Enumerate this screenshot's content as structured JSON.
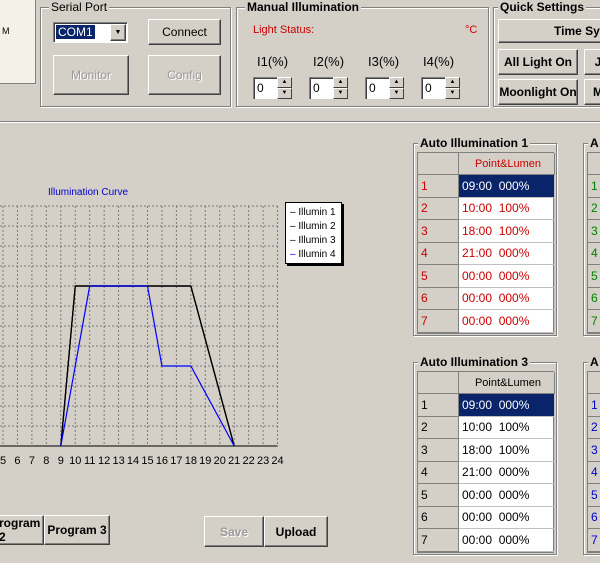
{
  "left_stub": {
    "text": "M"
  },
  "serial_port": {
    "title": "Serial Port",
    "port_value": "COM1",
    "connect_label": "Connect",
    "monitor_label": "Monitor",
    "config_label": "Config"
  },
  "manual": {
    "title": "Manual Illumination",
    "light_status_label": "Light Status:",
    "unit": "°C",
    "channels": [
      {
        "label": "I1(%)",
        "value": "0"
      },
      {
        "label": "I2(%)",
        "value": "0"
      },
      {
        "label": "I3(%)",
        "value": "0"
      },
      {
        "label": "I4(%)",
        "value": "0"
      }
    ]
  },
  "quick": {
    "title": "Quick Settings",
    "time_sync_label": "Time Syn",
    "all_light_on_label": "All Light On",
    "moonlight_on_label": "Moonlight On",
    "cut_btn1": "J",
    "cut_btn2": "M"
  },
  "chart_data": {
    "type": "line",
    "title": "Illumination Curve",
    "x_ticks": [
      "5",
      "6",
      "7",
      "8",
      "9",
      "10",
      "11",
      "12",
      "13",
      "14",
      "15",
      "16",
      "17",
      "18",
      "19",
      "20",
      "21",
      "22",
      "23",
      "24"
    ],
    "xlim": [
      5,
      24
    ],
    "ylim": [
      0,
      100
    ],
    "grid": true,
    "legend_position": "right",
    "series": [
      {
        "name": "Illumin 1",
        "color": "#000000",
        "x": [
          9,
          10,
          18,
          21
        ],
        "y": [
          0,
          100,
          100,
          0
        ]
      },
      {
        "name": "Illumin 2",
        "color": "#000000",
        "x": [
          9,
          10,
          18,
          21
        ],
        "y": [
          0,
          100,
          100,
          0
        ]
      },
      {
        "name": "Illumin 3",
        "color": "#000000",
        "x": [
          9,
          10,
          18,
          21
        ],
        "y": [
          0,
          100,
          100,
          0
        ]
      },
      {
        "name": "Illumin 4",
        "color": "#0000ff",
        "x": [
          9,
          11,
          15,
          16,
          18,
          21
        ],
        "y": [
          0,
          100,
          100,
          50,
          50,
          0
        ]
      }
    ]
  },
  "programs": {
    "program2_label": "rogram 2",
    "program3_label": "Program 3"
  },
  "actions": {
    "save_label": "Save",
    "upload_label": "Upload"
  },
  "auto1": {
    "title": "Auto Illumination 1",
    "header": "Point&Lumen",
    "rows": [
      {
        "num": "1",
        "value": "09:00  000%"
      },
      {
        "num": "2",
        "value": "10:00  100%"
      },
      {
        "num": "3",
        "value": "18:00  100%"
      },
      {
        "num": "4",
        "value": "21:00  000%"
      },
      {
        "num": "5",
        "value": "00:00  000%"
      },
      {
        "num": "6",
        "value": "00:00  000%"
      },
      {
        "num": "7",
        "value": "00:00  000%"
      }
    ],
    "text_color": "#cc0000"
  },
  "auto3": {
    "title": "Auto Illumination 3",
    "header": "Point&Lumen",
    "rows": [
      {
        "num": "1",
        "value": "09:00  000%"
      },
      {
        "num": "2",
        "value": "10:00  100%"
      },
      {
        "num": "3",
        "value": "18:00  100%"
      },
      {
        "num": "4",
        "value": "21:00  000%"
      },
      {
        "num": "5",
        "value": "00:00  000%"
      },
      {
        "num": "6",
        "value": "00:00  000%"
      },
      {
        "num": "7",
        "value": "00:00  000%"
      }
    ],
    "text_color": "#000000"
  },
  "auto2_partial": {
    "title": "A",
    "rows": [
      "1",
      "2",
      "3",
      "4",
      "5",
      "6",
      "7"
    ],
    "color": "#008000"
  },
  "auto4_partial": {
    "title": "A",
    "rows": [
      "1",
      "2",
      "3",
      "4",
      "5",
      "6",
      "7"
    ],
    "color": "#0000cc"
  }
}
